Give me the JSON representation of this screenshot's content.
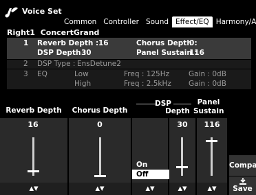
{
  "header": {
    "title": "Voice Set",
    "tabs": [
      {
        "label": "Common",
        "active": false
      },
      {
        "label": "Controller",
        "active": false
      },
      {
        "label": "Sound",
        "active": false
      },
      {
        "label": "Effect/EQ",
        "active": true
      },
      {
        "label": "Harmony/Arp",
        "active": false
      }
    ]
  },
  "voice": {
    "part": "Right1",
    "name": "ConcertGrand"
  },
  "effect_rows": {
    "row1": {
      "num": "1",
      "reverb_label": "Reverb Depth :",
      "reverb_value": "16",
      "chorus_label": "Chorus Depth :",
      "chorus_value": "0",
      "dsp_label": "DSP Depth :",
      "dsp_value": "30",
      "panel_label": "Panel Sustain :",
      "panel_value": "116"
    },
    "row2": {
      "num": "2",
      "label": "DSP Type :",
      "value": "EnsDetune2"
    },
    "row3": {
      "num": "3",
      "label": "EQ",
      "low_label": "Low",
      "low_freq": "Freq : 125Hz",
      "low_gain": "Gain : 0dB",
      "high_label": "High",
      "high_freq": "Freq : 2.5kHz",
      "high_gain": "Gain : 0dB"
    }
  },
  "params": {
    "reverb": {
      "label": "Reverb Depth",
      "value": "16",
      "level": 0.126
    },
    "chorus": {
      "label": "Chorus Depth",
      "value": "0",
      "level": 0.0
    },
    "dsp_group": "DSP",
    "dsp_onoff": {
      "on": "On",
      "off": "Off",
      "selected": "Off"
    },
    "dsp_depth": {
      "label": "Depth",
      "value": "30",
      "level": 0.236
    },
    "panel": {
      "label_line1": "Panel",
      "label_line2": "Sustain",
      "value": "116",
      "level": 0.913
    }
  },
  "arrows": "▲▼",
  "buttons": {
    "compare": "Compare",
    "save": "Save"
  }
}
